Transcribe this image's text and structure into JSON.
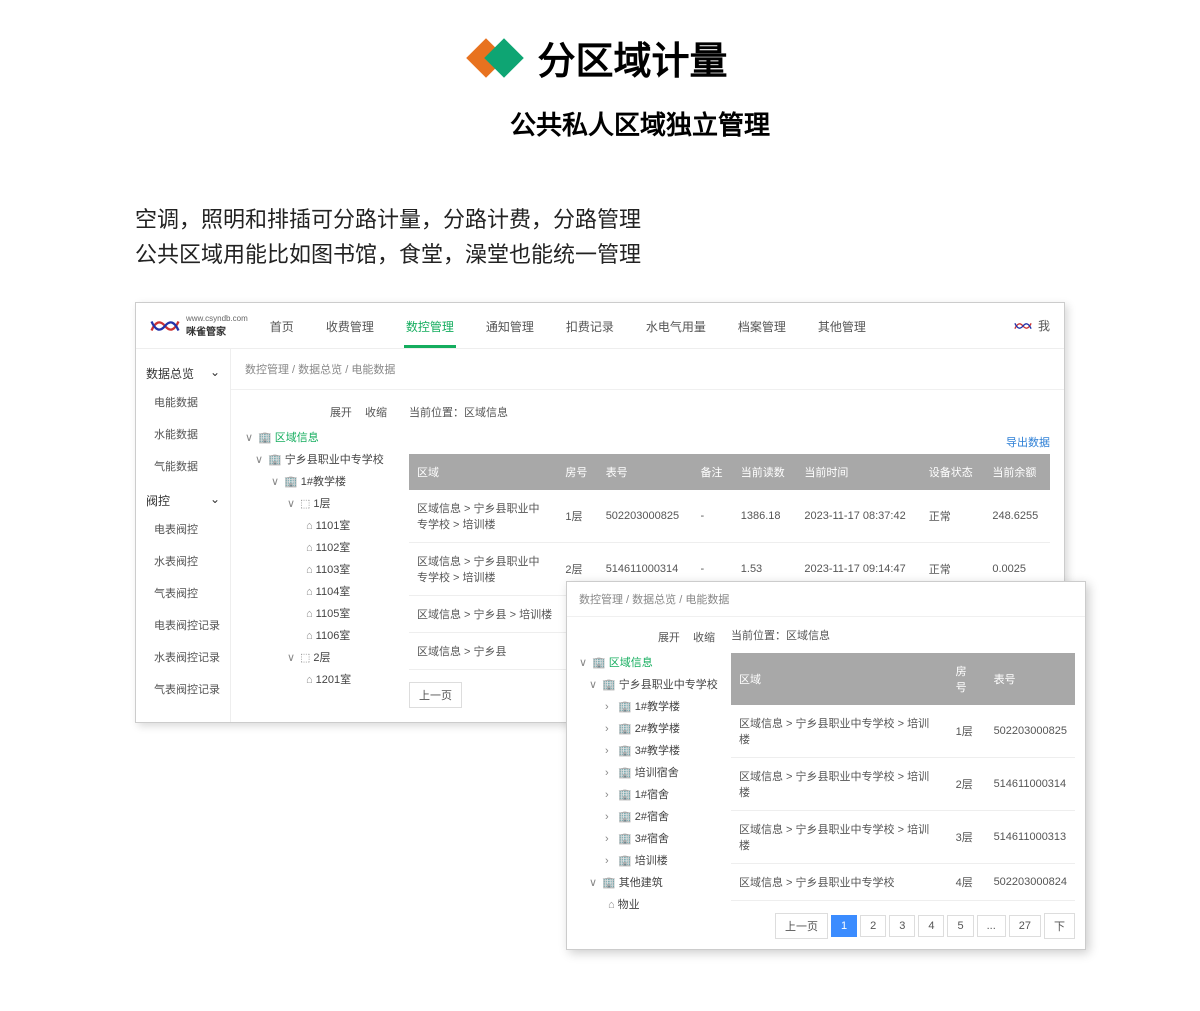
{
  "header": {
    "title": "分区域计量",
    "subtitle": "公共私人区域独立管理"
  },
  "description": {
    "line1": "空调，照明和排插可分路计量，分路计费，分路管理",
    "line2": "公共区域用能比如图书馆，食堂，澡堂也能统一管理"
  },
  "app": {
    "logo_url_label": "www.csyndb.com",
    "logo_name": "咪雀管家",
    "nav": [
      "首页",
      "收费管理",
      "数控管理",
      "通知管理",
      "扣费记录",
      "水电气用量",
      "档案管理",
      "其他管理"
    ],
    "nav_active_idx": 2,
    "user_label": "我",
    "breadcrumb": [
      "数控管理",
      "数据总览",
      "电能数据"
    ],
    "sidebar": {
      "group1_label": "数据总览",
      "group1_items": [
        "电能数据",
        "水能数据",
        "气能数据"
      ],
      "group2_label": "阀控",
      "group2_items": [
        "电表阀控",
        "水表阀控",
        "气表阀控",
        "电表阀控记录",
        "水表阀控记录",
        "气表阀控记录"
      ]
    },
    "tree_actions": {
      "expand": "展开",
      "collapse": "收缩"
    },
    "tree": {
      "root": "区域信息",
      "school": "宁乡县职业中专学校",
      "b1": "1#教学楼",
      "f1": "1层",
      "rooms_f1": [
        "1101室",
        "1102室",
        "1103室",
        "1104室",
        "1105室",
        "1106室"
      ],
      "f2": "2层",
      "room_f2": "1201室"
    },
    "position_label": "当前位置：",
    "position_value": "区域信息",
    "export_label": "导出数据",
    "table": {
      "headers": [
        "区域",
        "房号",
        "表号",
        "备注",
        "当前读数",
        "当前时间",
        "设备状态",
        "当前余额"
      ],
      "rows": [
        {
          "zone": "区域信息 > 宁乡县职业中专学校 > 培训楼",
          "room": "1层",
          "meter": "502203000825",
          "note": "-",
          "read": "1386.18",
          "time": "2023-11-17 08:37:42",
          "status": "正常",
          "balance": "248.6255"
        },
        {
          "zone": "区域信息 > 宁乡县职业中专学校 > 培训楼",
          "room": "2层",
          "meter": "514611000314",
          "note": "-",
          "read": "1.53",
          "time": "2023-11-17 09:14:47",
          "status": "正常",
          "balance": "0.0025"
        }
      ],
      "partial_rows": [
        {
          "zone": "区域信息 > 宁乡县 > 培训楼"
        },
        {
          "zone": "区域信息 > 宁乡县"
        }
      ]
    },
    "pager": {
      "prev": "上一页"
    }
  },
  "overlay": {
    "breadcrumb": [
      "数控管理",
      "数据总览",
      "电能数据"
    ],
    "tree_actions": {
      "expand": "展开",
      "collapse": "收缩"
    },
    "position_label": "当前位置：",
    "position_value": "区域信息",
    "tree": {
      "root": "区域信息",
      "school": "宁乡县职业中专学校",
      "nodes": [
        "1#教学楼",
        "2#教学楼",
        "3#教学楼",
        "培训宿舍",
        "1#宿舍",
        "2#宿舍",
        "3#宿舍",
        "培训楼"
      ],
      "other": "其他建筑",
      "prop": "物业"
    },
    "table": {
      "headers": [
        "区域",
        "房号",
        "表号"
      ],
      "rows": [
        {
          "zone": "区域信息 > 宁乡县职业中专学校 > 培训楼",
          "room": "1层",
          "meter": "502203000825"
        },
        {
          "zone": "区域信息 > 宁乡县职业中专学校 > 培训楼",
          "room": "2层",
          "meter": "514611000314"
        },
        {
          "zone": "区域信息 > 宁乡县职业中专学校 > 培训楼",
          "room": "3层",
          "meter": "514611000313"
        },
        {
          "zone": "区域信息 > 宁乡县职业中专学校",
          "room": "4层",
          "meter": "502203000824"
        }
      ]
    },
    "pager": {
      "prev": "上一页",
      "pages": [
        "1",
        "2",
        "3",
        "4",
        "5",
        "...",
        "27"
      ],
      "next": "下"
    }
  }
}
